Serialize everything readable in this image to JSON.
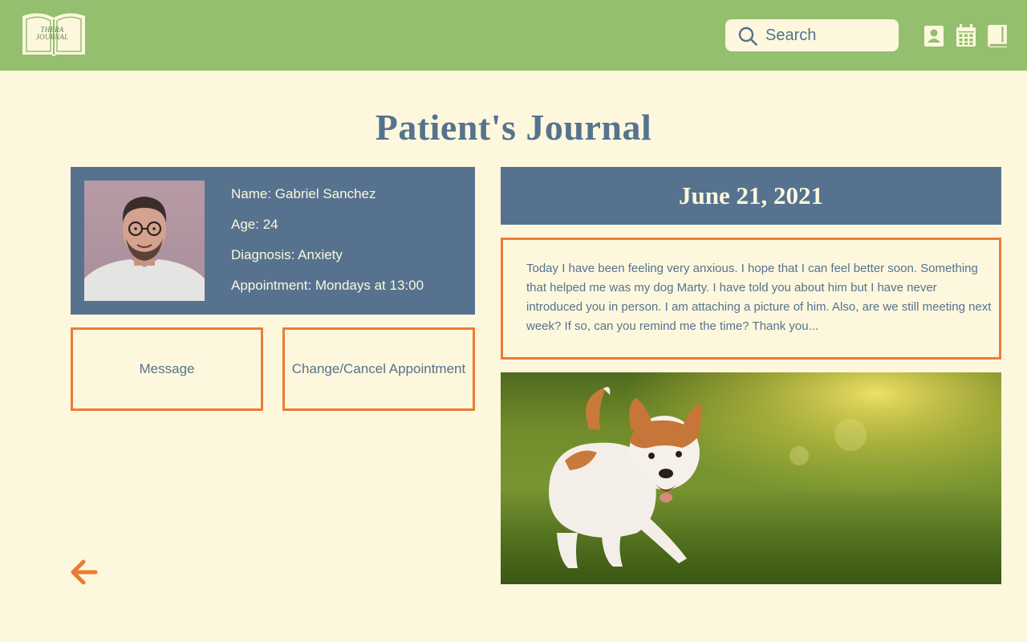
{
  "header": {
    "logo_text": "THERA JOURNAL",
    "search_placeholder": "Search",
    "icons": [
      "profile-icon",
      "calendar-icon",
      "book-icon"
    ]
  },
  "page_title": "Patient's Journal",
  "patient": {
    "name": "Name: Gabriel Sanchez",
    "age": "Age: 24",
    "diagnosis": "Diagnosis: Anxiety",
    "appointment": "Appointment: Mondays at 13:00"
  },
  "actions": {
    "message_label": "Message",
    "change_label": "Change/Cancel Appointment"
  },
  "entry": {
    "date": "June 21, 2021",
    "text": "Today I have been feeling very anxious. I hope that I can feel better soon. Something that helped me was my dog Marty. I have told you about him but I have never introduced you in person. I am attaching a picture of him. Also, are we still meeting next week? If so, can you remind me the time? Thank you..."
  },
  "colors": {
    "header_bg": "#93bf6e",
    "page_bg": "#fdf8dd",
    "primary_blue": "#56728f",
    "accent_orange": "#ec7b35"
  }
}
